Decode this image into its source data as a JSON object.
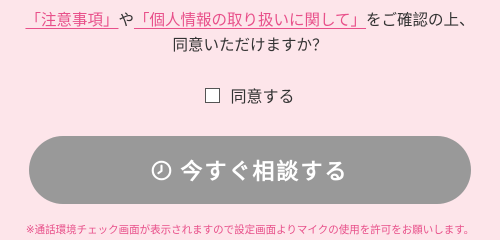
{
  "consent": {
    "link_notes": "「注意事項」",
    "connector": "や",
    "link_privacy": "「個人情報の取り扱いに関して」",
    "suffix": "をご確認の上、",
    "question": "同意いただけますか？"
  },
  "agree": {
    "label": "同意する",
    "checked": false
  },
  "consult_button": {
    "label": "今すぐ相談する",
    "icon": "clock-icon"
  },
  "notice": "※通話環境チェック画面が表示されますので設定画面よりマイクの使用を許可をお願いします。",
  "colors": {
    "background": "#fde5ea",
    "link": "#e8508a",
    "button": "#999999",
    "notice": "#e8508a"
  }
}
